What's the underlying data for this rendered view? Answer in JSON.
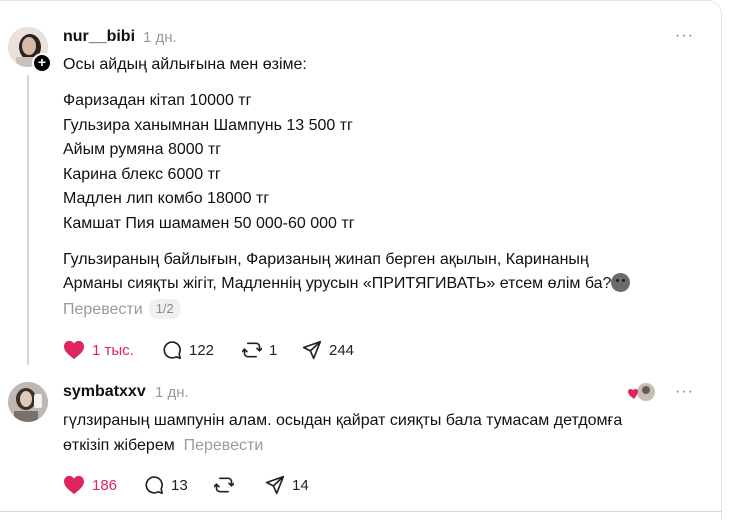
{
  "post": {
    "username": "nur__bibi",
    "time": "1 дн.",
    "intro": "Осы айдың айлығына мен өзіме:",
    "items": [
      "Фаризадан кітап 10000 тг",
      "Гульзира ханымнан Шампунь 13 500 тг",
      "Айым румяна 8000 тг",
      "Карина блекс 6000 тг",
      "Мадлен лип комбо 18000 тг",
      "Камшат Пия шамамен 50 000-60 000 тг"
    ],
    "closing_line1": "Гульзираның байлығын, Фаризаның жинап берген ақылын, Каринаның",
    "closing_line2": "Арманы сияқты жігіт, Мадленнің урусын «ПРИТЯГИВАТЬ» етсем өлім ба?",
    "translate_label": "Перевести",
    "pager": "1/2",
    "likes": "1 тыс.",
    "comments": "122",
    "reposts": "1",
    "shares": "244",
    "more_label": "···",
    "follow_badge": "+"
  },
  "reply": {
    "username": "symbatxxv",
    "time": "1 дн.",
    "line1": "гүлзираның шампунін алам. осыдан қайрат сияқты бала тумасам детдомға",
    "line2": "өткізіп жіберем",
    "translate_label": "Перевести",
    "likes": "186",
    "comments": "13",
    "reposts": "",
    "shares": "14",
    "more_label": "···"
  },
  "colors": {
    "like_red": "#e0245e",
    "muted_text": "#999999",
    "thread_line": "#d6d6d6"
  },
  "icons": [
    "heart-icon",
    "comment-icon",
    "repost-icon",
    "share-icon",
    "more-icon",
    "plus-icon",
    "emoji-icon"
  ]
}
